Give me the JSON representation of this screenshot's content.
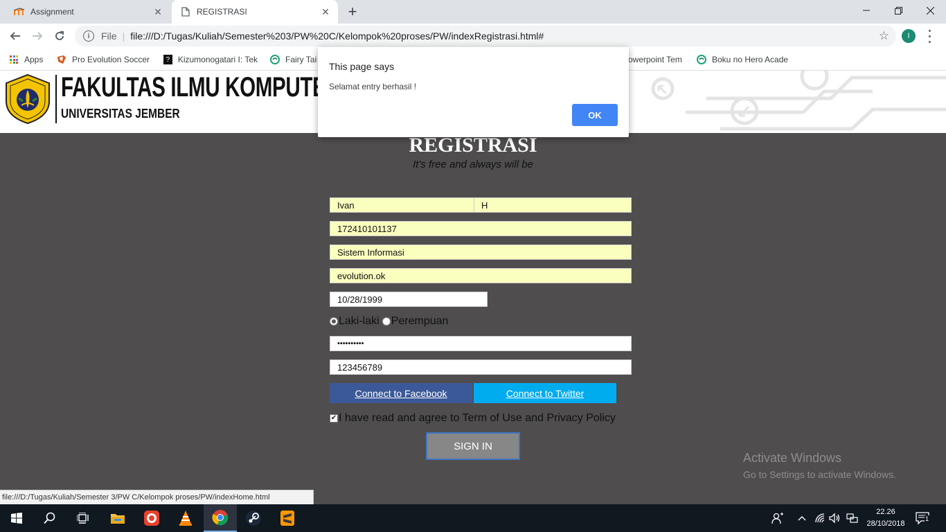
{
  "browser": {
    "tabs": [
      {
        "title": "Assignment",
        "icon": "moodle-icon",
        "active": false
      },
      {
        "title": "REGISTRASI",
        "icon": "document-icon",
        "active": true
      }
    ],
    "address": {
      "scheme": "File",
      "url": "file:///D:/Tugas/Kuliah/Semester%203/PW%20C/Kelompok%20proses/PW/indexRegistrasi.html#"
    },
    "profile_initial": "I",
    "bookmarks": [
      {
        "label": "Apps",
        "icon": "apps-grid-icon"
      },
      {
        "label": "Pro Evolution Soccer",
        "icon": "pes-icon"
      },
      {
        "label": "Kizumonogatari I: Tek",
        "icon": "bookmark-favicon"
      },
      {
        "label": "Fairy Tail",
        "icon": "bookmark-favicon"
      },
      {
        "label": "owerpoint Tem",
        "icon": "bookmark-favicon"
      },
      {
        "label": "Boku no Hero Acade",
        "icon": "bookmark-favicon"
      }
    ]
  },
  "dialog": {
    "title": "This page says",
    "message": "Selamat entry berhasil !",
    "ok_label": "OK"
  },
  "header": {
    "faculty": "FAKULTAS ILMU KOMPUTER",
    "university": "UNIVERSITAS JEMBER",
    "logo_text_top": "UNIVERSITAS",
    "logo_text_bottom": "JEMBER"
  },
  "form": {
    "title": "REGISTRASI",
    "subtitle": "It's free and always will be",
    "first_name": "Ivan",
    "last_name": "H",
    "nim": "172410101137",
    "program": "Sistem Informasi",
    "username": "evolution.ok",
    "birthdate": "10/28/1999",
    "gender_options": [
      "Laki-laki",
      "Perempuan"
    ],
    "gender_selected": "Laki-laki",
    "password_masked": "••••••••••",
    "phone": "123456789",
    "facebook_label": "Connect to Facebook",
    "twitter_label": "Connect to Twitter",
    "agree_label": "I have read and agree to Term of Use and Privacy Policy",
    "agree_checked": true,
    "signin_label": "SIGN IN"
  },
  "colors": {
    "page_bg": "#4f4d4e",
    "autofill": "#faffbd",
    "facebook": "#3b5998",
    "twitter": "#00aced",
    "signin": "#878787",
    "dialog_ok": "#4285f4"
  },
  "watermark": {
    "line1": "Activate Windows",
    "line2": "Go to Settings to activate Windows."
  },
  "status_url": "file:///D:/Tugas/Kuliah/Semester 3/PW C/Kelompok proses/PW/indexHome.html",
  "taskbar": {
    "apps": [
      "start-icon",
      "search-icon",
      "task-view-icon",
      "file-explorer-icon",
      "screen-recorder-icon",
      "vlc-icon",
      "chrome-icon",
      "steam-icon",
      "sublime-text-icon"
    ],
    "time": "22.26",
    "date": "28/10/2018",
    "notifications": "1"
  }
}
